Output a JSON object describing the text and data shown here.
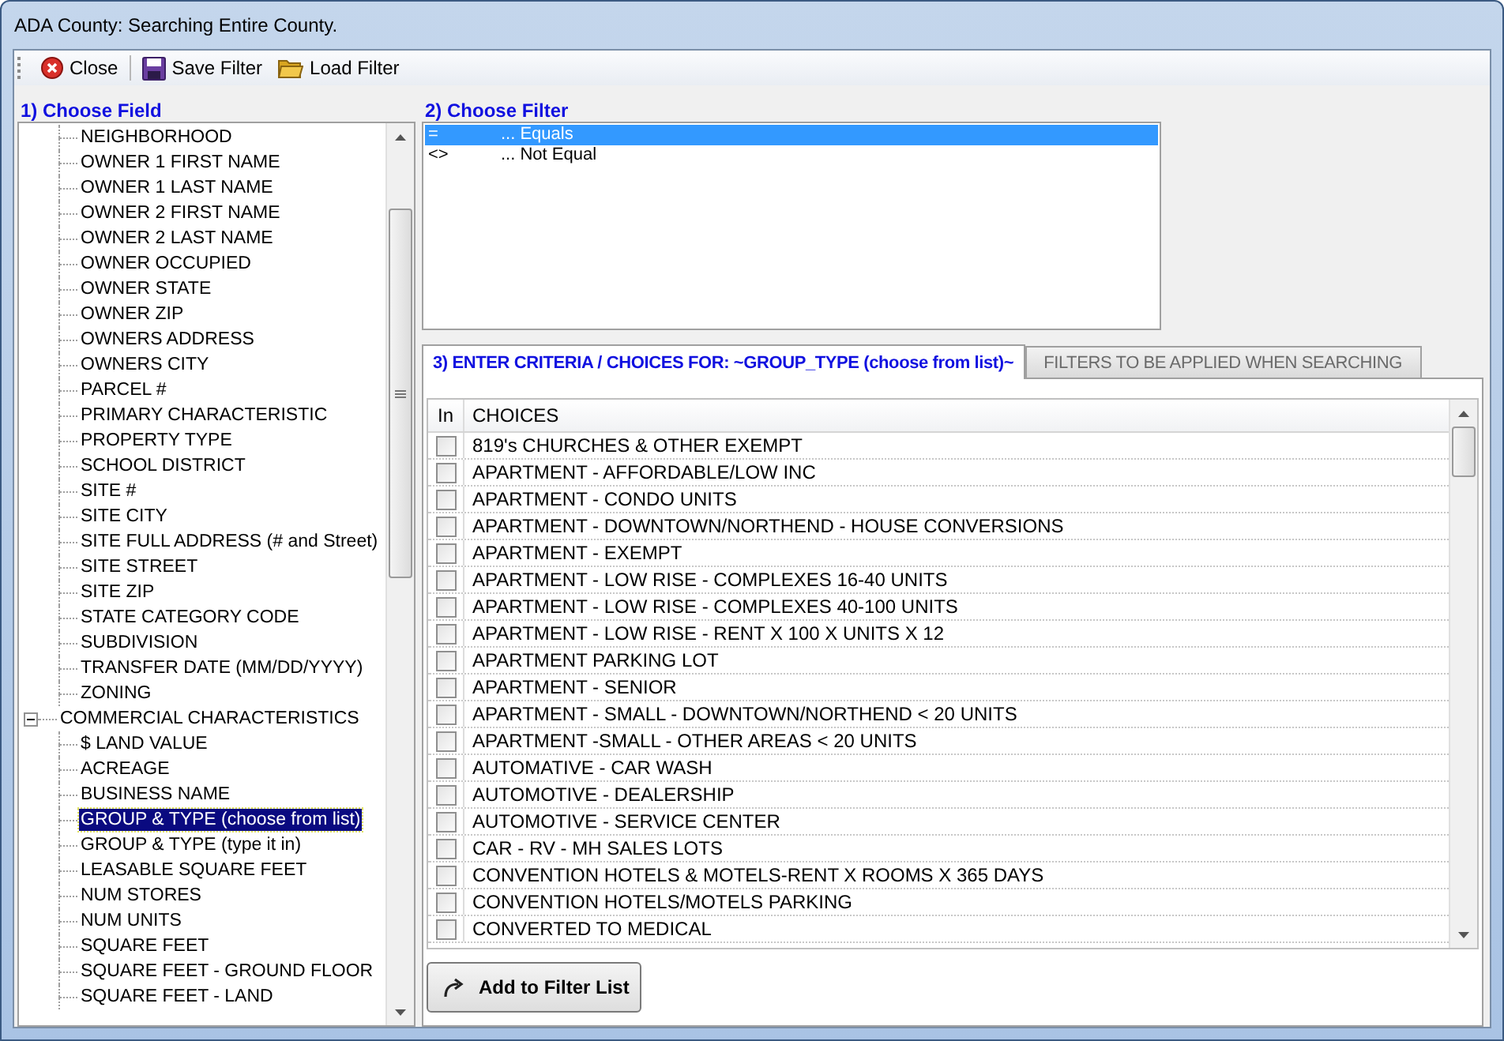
{
  "window": {
    "title": "ADA County: Searching Entire County."
  },
  "toolbar": [
    {
      "kind": "close",
      "label": "Close"
    },
    {
      "kind": "save",
      "label": "Save Filter"
    },
    {
      "kind": "load",
      "label": "Load Filter"
    }
  ],
  "field_panel": {
    "heading": "1)  Choose Field",
    "branches": [
      {
        "children": [
          {
            "label": "NEIGHBORHOOD",
            "selected": false
          },
          {
            "label": "OWNER 1 FIRST NAME",
            "selected": false
          },
          {
            "label": "OWNER 1 LAST NAME",
            "selected": false
          },
          {
            "label": "OWNER 2 FIRST NAME",
            "selected": false
          },
          {
            "label": "OWNER 2 LAST NAME",
            "selected": false
          },
          {
            "label": "OWNER OCCUPIED",
            "selected": false
          },
          {
            "label": "OWNER STATE",
            "selected": false
          },
          {
            "label": "OWNER ZIP",
            "selected": false
          },
          {
            "label": "OWNERS ADDRESS",
            "selected": false
          },
          {
            "label": "OWNERS CITY",
            "selected": false
          },
          {
            "label": "PARCEL #",
            "selected": false
          },
          {
            "label": "PRIMARY CHARACTERISTIC",
            "selected": false
          },
          {
            "label": "PROPERTY TYPE",
            "selected": false
          },
          {
            "label": "SCHOOL DISTRICT",
            "selected": false
          },
          {
            "label": "SITE #",
            "selected": false
          },
          {
            "label": "SITE CITY",
            "selected": false
          },
          {
            "label": "SITE FULL ADDRESS (# and Street)",
            "selected": false
          },
          {
            "label": "SITE STREET",
            "selected": false
          },
          {
            "label": "SITE ZIP",
            "selected": false
          },
          {
            "label": "STATE CATEGORY CODE",
            "selected": false
          },
          {
            "label": "SUBDIVISION",
            "selected": false
          },
          {
            "label": "TRANSFER DATE (MM/DD/YYYY)",
            "selected": false
          },
          {
            "label": "ZONING",
            "selected": false
          }
        ]
      },
      {
        "label": "COMMERCIAL CHARACTERISTICS",
        "expanded": true,
        "children": [
          {
            "label": "$ LAND VALUE",
            "selected": false
          },
          {
            "label": "ACREAGE",
            "selected": false
          },
          {
            "label": "BUSINESS NAME",
            "selected": false
          },
          {
            "label": "GROUP & TYPE (choose from list)",
            "selected": true
          },
          {
            "label": "GROUP & TYPE (type it in)",
            "selected": false
          },
          {
            "label": "LEASABLE SQUARE FEET",
            "selected": false
          },
          {
            "label": "NUM STORES",
            "selected": false
          },
          {
            "label": "NUM UNITS",
            "selected": false
          },
          {
            "label": "SQUARE FEET",
            "selected": false
          },
          {
            "label": "SQUARE FEET - GROUND FLOOR",
            "selected": false
          },
          {
            "label": "SQUARE FEET - LAND",
            "selected": false
          }
        ]
      }
    ]
  },
  "filter_panel": {
    "heading": "2)  Choose Filter",
    "options": [
      {
        "symbol": "=",
        "label": "... Equals",
        "selected": true
      },
      {
        "symbol": "<>",
        "label": "... Not Equal",
        "selected": false
      }
    ]
  },
  "tabs": [
    {
      "label": "3)  ENTER CRITERIA / CHOICES FOR: ~GROUP_TYPE (choose from list)~",
      "selected": true
    },
    {
      "label": "FILTERS TO BE APPLIED WHEN SEARCHING",
      "selected": false
    }
  ],
  "choices_table": {
    "columns": [
      "In",
      "CHOICES"
    ],
    "rows": [
      {
        "label": "819's CHURCHES & OTHER EXEMPT",
        "checked": false
      },
      {
        "label": "APARTMENT - AFFORDABLE/LOW INC",
        "checked": false
      },
      {
        "label": "APARTMENT - CONDO UNITS",
        "checked": false
      },
      {
        "label": "APARTMENT - DOWNTOWN/NORTHEND - HOUSE CONVERSIONS",
        "checked": false
      },
      {
        "label": "APARTMENT - EXEMPT",
        "checked": false
      },
      {
        "label": "APARTMENT - LOW RISE - COMPLEXES 16-40 UNITS",
        "checked": false
      },
      {
        "label": "APARTMENT - LOW RISE - COMPLEXES 40-100 UNITS",
        "checked": false
      },
      {
        "label": "APARTMENT - LOW RISE - RENT X 100 X UNITS X 12",
        "checked": false
      },
      {
        "label": "APARTMENT  PARKING LOT",
        "checked": false
      },
      {
        "label": "APARTMENT - SENIOR",
        "checked": false
      },
      {
        "label": "APARTMENT - SMALL - DOWNTOWN/NORTHEND < 20 UNITS",
        "checked": false
      },
      {
        "label": "APARTMENT -SMALL - OTHER AREAS < 20 UNITS",
        "checked": false
      },
      {
        "label": "AUTOMATIVE - CAR WASH",
        "checked": false
      },
      {
        "label": "AUTOMOTIVE - DEALERSHIP",
        "checked": false
      },
      {
        "label": "AUTOMOTIVE - SERVICE CENTER",
        "checked": false
      },
      {
        "label": "CAR - RV - MH SALES LOTS",
        "checked": false
      },
      {
        "label": "CONVENTION HOTELS & MOTELS-RENT X ROOMS X 365 DAYS",
        "checked": false
      },
      {
        "label": "CONVENTION HOTELS/MOTELS PARKING",
        "checked": false
      },
      {
        "label": "CONVERTED TO MEDICAL",
        "checked": false
      }
    ]
  },
  "add_button": {
    "label": "Add to Filter List"
  }
}
